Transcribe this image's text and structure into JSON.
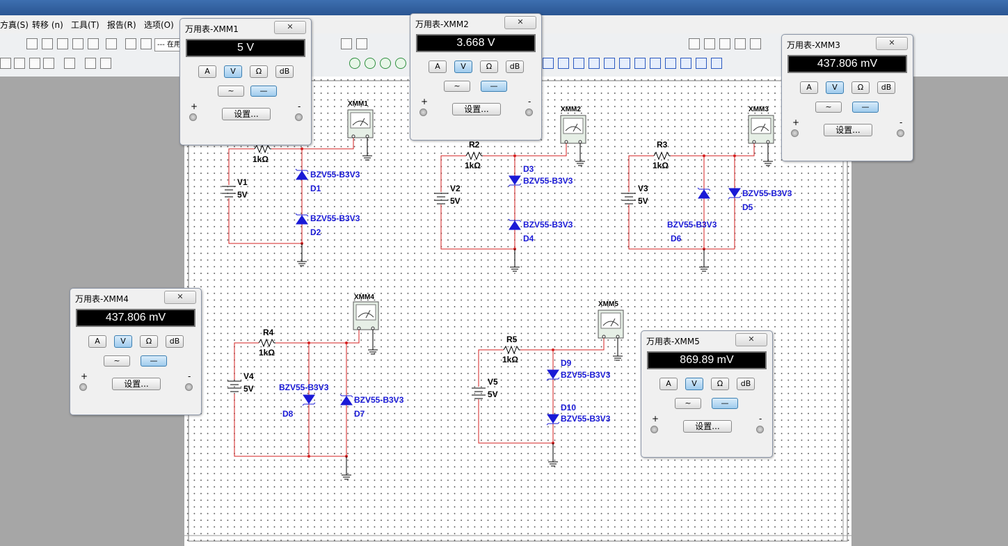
{
  "menu": [
    "方真(S)",
    "转移 (n)",
    "工具(T)",
    "报告(R)",
    "选项(O)"
  ],
  "toolbar": {
    "combo_text": "--- 在用"
  },
  "components": {
    "resistors": [
      {
        "ref": "R1",
        "value": "1kΩ"
      },
      {
        "ref": "R2",
        "value": "1kΩ"
      },
      {
        "ref": "R3",
        "value": "1kΩ"
      },
      {
        "ref": "R4",
        "value": "1kΩ"
      },
      {
        "ref": "R5",
        "value": "1kΩ"
      }
    ],
    "sources": [
      {
        "ref": "V1",
        "value": "5V"
      },
      {
        "ref": "V2",
        "value": "5V"
      },
      {
        "ref": "V3",
        "value": "5V"
      },
      {
        "ref": "V4",
        "value": "5V"
      },
      {
        "ref": "V5",
        "value": "5V"
      }
    ],
    "zener_model": "BZV55-B3V3",
    "diodes": [
      "D1",
      "D2",
      "D3",
      "D4",
      "D5",
      "D6",
      "D7",
      "D8",
      "D9",
      "D10"
    ],
    "meter_symbols": [
      "XMM1",
      "XMM2",
      "XMM3",
      "XMM4",
      "XMM5"
    ]
  },
  "multimeters": [
    {
      "title": "万用表-XMM1",
      "reading": "5 V"
    },
    {
      "title": "万用表-XMM2",
      "reading": "3.668 V"
    },
    {
      "title": "万用表-XMM3",
      "reading": "437.806 mV"
    },
    {
      "title": "万用表-XMM4",
      "reading": "437.806 mV"
    },
    {
      "title": "万用表-XMM5",
      "reading": "869.89 mV"
    }
  ],
  "meter_controls": {
    "modes": [
      "A",
      "V",
      "Ω",
      "dB"
    ],
    "selected_mode": "V",
    "waves": [
      "~",
      "—"
    ],
    "selected_wave": "DC",
    "settings_label": "设置...",
    "plus": "+",
    "minus": "-",
    "close": "✕"
  },
  "colors": {
    "wire": "#d42020",
    "zener": "#1a1ad6",
    "display_bg": "#000000"
  }
}
